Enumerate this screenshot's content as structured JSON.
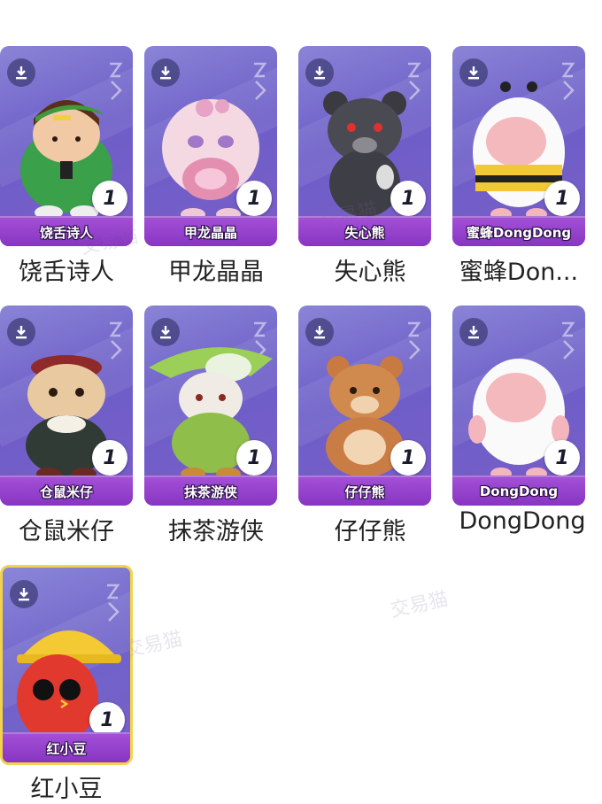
{
  "items": [
    {
      "name": "饶舌诗人",
      "caption": "饶舌诗人",
      "count": "1"
    },
    {
      "name": "甲龙晶晶",
      "caption": "甲龙晶晶",
      "count": "1"
    },
    {
      "name": "失心熊",
      "caption": "失心熊",
      "count": "1"
    },
    {
      "name": "蜜蜂DongDong",
      "caption": "蜜蜂Don...",
      "count": "1"
    },
    {
      "name": "仓鼠米仔",
      "caption": "仓鼠米仔",
      "count": "1"
    },
    {
      "name": "抹茶游侠",
      "caption": "抹茶游侠",
      "count": "1"
    },
    {
      "name": "仔仔熊",
      "caption": "仔仔熊",
      "count": "1"
    },
    {
      "name": "DongDong",
      "caption": "DongDong",
      "count": "1"
    },
    {
      "name": "红小豆",
      "caption": "红小豆",
      "count": "1"
    }
  ],
  "watermark": "交易猫",
  "colors": {
    "card": "#7366cc",
    "band": "#8f3bc8",
    "selected_border": "#f3d34a"
  }
}
